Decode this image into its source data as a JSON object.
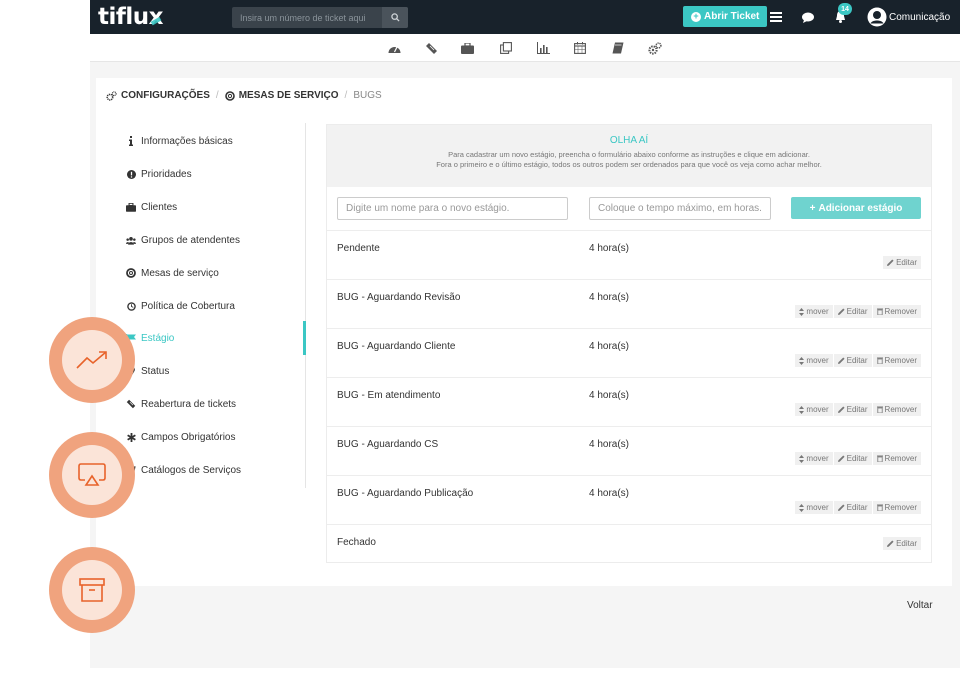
{
  "brand": {
    "logo": "tiflux"
  },
  "topbar": {
    "search_placeholder": "Insira um número de ticket aqui",
    "open_ticket_label": "Abrir Ticket",
    "notification_count": "14",
    "user_name": "Comunicação"
  },
  "breadcrumb": {
    "root": "CONFIGURAÇÕES",
    "parent": "MESAS DE SERVIÇO",
    "current": "BUGS"
  },
  "sidebar": {
    "items": [
      {
        "label": "Informações básicas",
        "icon": "info-icon"
      },
      {
        "label": "Prioridades",
        "icon": "exclamation-circle-icon"
      },
      {
        "label": "Clientes",
        "icon": "briefcase-icon"
      },
      {
        "label": "Grupos de atendentes",
        "icon": "users-icon"
      },
      {
        "label": "Mesas de serviço",
        "icon": "lifebuoy-icon"
      },
      {
        "label": "Política de Cobertura",
        "icon": "clock-icon"
      },
      {
        "label": "Estágio",
        "icon": "flag-icon"
      },
      {
        "label": "Status",
        "icon": "map-pin-icon"
      },
      {
        "label": "Reabertura de tickets",
        "icon": "ticket-icon"
      },
      {
        "label": "Campos Obrigatórios",
        "icon": "asterisk-icon"
      },
      {
        "label": "Catálogos de Serviços",
        "icon": "book-icon"
      }
    ],
    "active_index": 6
  },
  "notice": {
    "title": "OLHA AÍ",
    "line1": "Para cadastrar um novo estágio, preencha o formulário abaixo conforme as instruções e clique em adicionar.",
    "line2": "Fora o primeiro e o último estágio, todos os outros podem ser ordenados para que você os veja como achar melhor."
  },
  "form": {
    "name_placeholder": "Digite um nome para o novo estágio.",
    "time_placeholder": "Coloque o tempo máximo, em horas.",
    "add_label": "Adicionar estágio"
  },
  "actions": {
    "move": "mover",
    "edit": "Editar",
    "remove": "Remover"
  },
  "stages": [
    {
      "name": "Pendente",
      "time": "4 hora(s)",
      "movable": false
    },
    {
      "name": "BUG - Aguardando Revisão",
      "time": "4 hora(s)",
      "movable": true
    },
    {
      "name": "BUG - Aguardando Cliente",
      "time": "4 hora(s)",
      "movable": true
    },
    {
      "name": "BUG - Em atendimento",
      "time": "4 hora(s)",
      "movable": true
    },
    {
      "name": "BUG - Aguardando CS",
      "time": "4 hora(s)",
      "movable": true
    },
    {
      "name": "BUG - Aguardando Publicação",
      "time": "4 hora(s)",
      "movable": true
    },
    {
      "name": "Fechado",
      "time": "",
      "movable": false
    }
  ],
  "footer": {
    "back_label": "Voltar"
  },
  "colors": {
    "topbar": "#18222b",
    "accent": "#3bc7c4",
    "float_ring": "#f0a37e",
    "float_inner": "#fbe4d8",
    "float_icon": "#e8632b"
  },
  "floating_icons": [
    "trending-up-icon",
    "airplay-icon",
    "archive-icon"
  ]
}
